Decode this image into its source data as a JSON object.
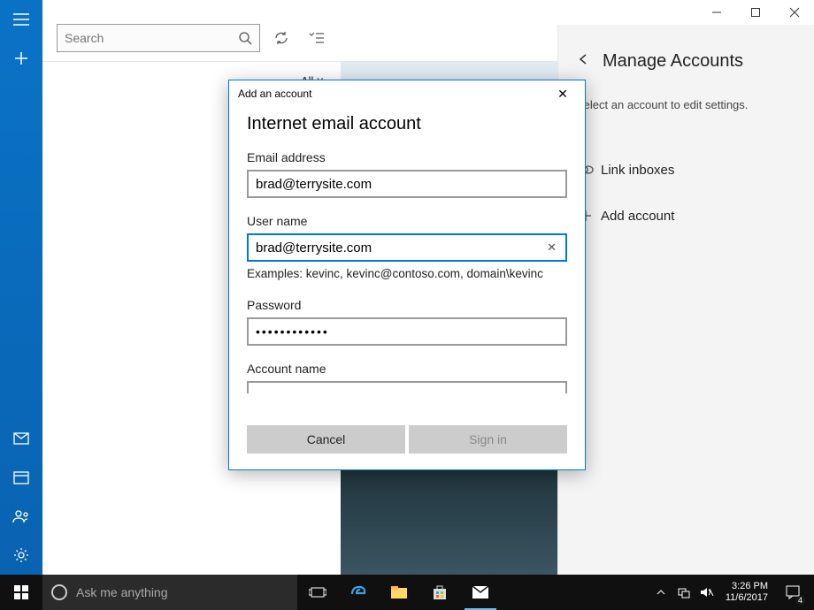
{
  "window": {
    "min": "—",
    "max": "▢",
    "close": "✕"
  },
  "rail": {
    "items": [
      "menu",
      "compose",
      "mail",
      "calendar",
      "people",
      "settings"
    ]
  },
  "toolbar": {
    "search_placeholder": "Search"
  },
  "list": {
    "filter": "All ˅"
  },
  "panel": {
    "title": "Manage Accounts",
    "subtitle": "Select an account to edit settings.",
    "link_inboxes": "Link inboxes",
    "add_account": "Add account"
  },
  "dialog": {
    "title": "Add an account",
    "heading": "Internet email account",
    "email_label": "Email address",
    "email_value": "brad@terrysite.com",
    "user_label": "User name",
    "user_value": "brad@terrysite.com",
    "user_hint": "Examples: kevinc, kevinc@contoso.com, domain\\kevinc",
    "pwd_label": "Password",
    "pwd_value": "••••••••••••",
    "acct_label": "Account name",
    "cancel": "Cancel",
    "signin": "Sign in",
    "clear": "✕"
  },
  "taskbar": {
    "cortana": "Ask me anything",
    "time": "3:26 PM",
    "date": "11/6/2017",
    "notif_count": "4"
  }
}
